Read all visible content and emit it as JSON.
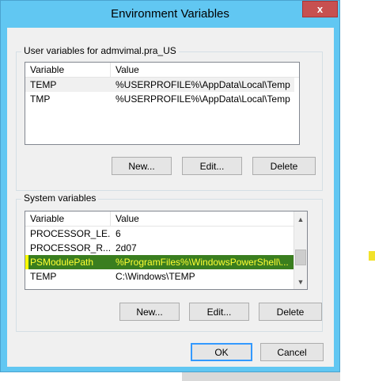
{
  "window": {
    "title": "Environment Variables",
    "close_glyph": "x"
  },
  "user_vars": {
    "label": "User variables for admvimal.pra_US",
    "columns": [
      "Variable",
      "Value"
    ],
    "rows": [
      {
        "variable": "TEMP",
        "value": "%USERPROFILE%\\AppData\\Local\\Temp"
      },
      {
        "variable": "TMP",
        "value": "%USERPROFILE%\\AppData\\Local\\Temp"
      }
    ],
    "buttons": {
      "new": "New...",
      "edit": "Edit...",
      "delete": "Delete"
    }
  },
  "system_vars": {
    "label": "System variables",
    "columns": [
      "Variable",
      "Value"
    ],
    "rows": [
      {
        "variable": "PROCESSOR_LE...",
        "value": "6"
      },
      {
        "variable": "PROCESSOR_R...",
        "value": "2d07"
      },
      {
        "variable": "PSModulePath",
        "value": "%ProgramFiles%\\WindowsPowerShell\\..."
      },
      {
        "variable": "TEMP",
        "value": "C:\\Windows\\TEMP"
      }
    ],
    "selected_row": 2,
    "buttons": {
      "new": "New...",
      "edit": "Edit...",
      "delete": "Delete"
    }
  },
  "footer": {
    "ok": "OK",
    "cancel": "Cancel"
  },
  "colors": {
    "title_bar": "#61c7f2",
    "close_button": "#c75050",
    "selection_bg": "#3a7e1f",
    "selection_text": "#ffff33"
  },
  "icons": {
    "scroll_up": "chevron-up-icon",
    "scroll_down": "chevron-down-icon",
    "close": "close-icon"
  }
}
